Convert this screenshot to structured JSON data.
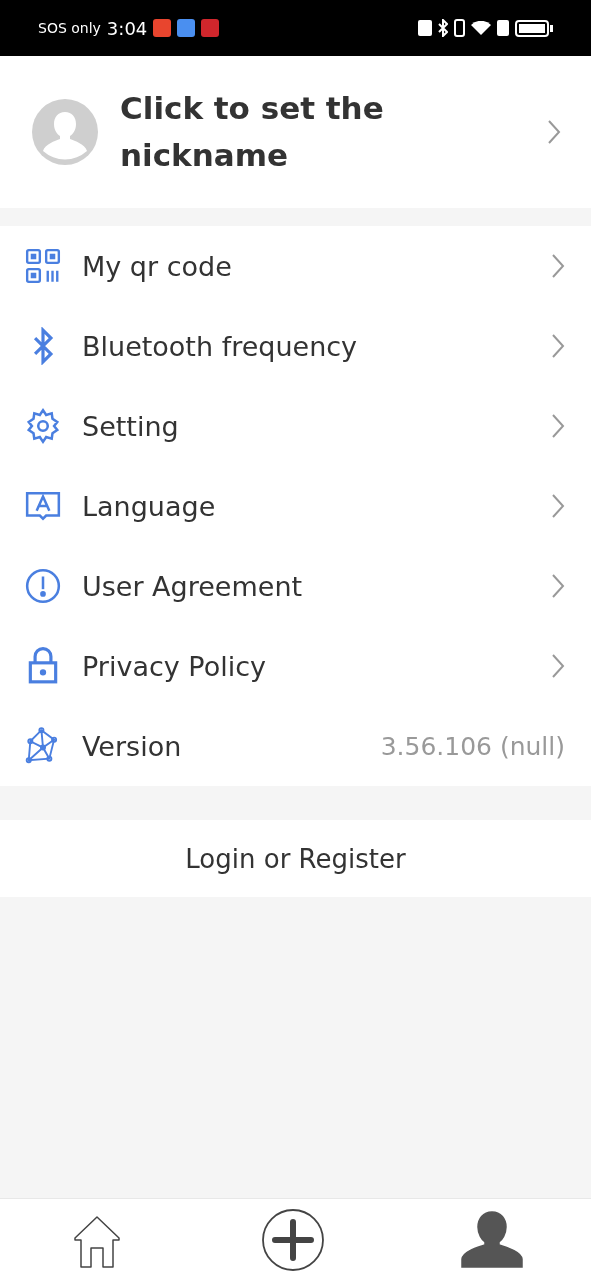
{
  "status_bar": {
    "carrier": "SOS only",
    "time": "3:04"
  },
  "profile": {
    "nickname": "Click to set the nickname"
  },
  "menu": [
    {
      "kind": "link",
      "label": "My qr code"
    },
    {
      "kind": "link",
      "label": "Bluetooth frequency"
    },
    {
      "kind": "link",
      "label": "Setting"
    },
    {
      "kind": "link",
      "label": "Language"
    },
    {
      "kind": "link",
      "label": "User Agreement"
    },
    {
      "kind": "link",
      "label": "Privacy Policy"
    },
    {
      "kind": "value",
      "label": "Version",
      "value": "3.56.106 (null)"
    }
  ],
  "login_button": "Login or Register",
  "bottom_nav": [
    {
      "selected": false
    },
    {
      "selected": false
    },
    {
      "selected": true
    }
  ]
}
